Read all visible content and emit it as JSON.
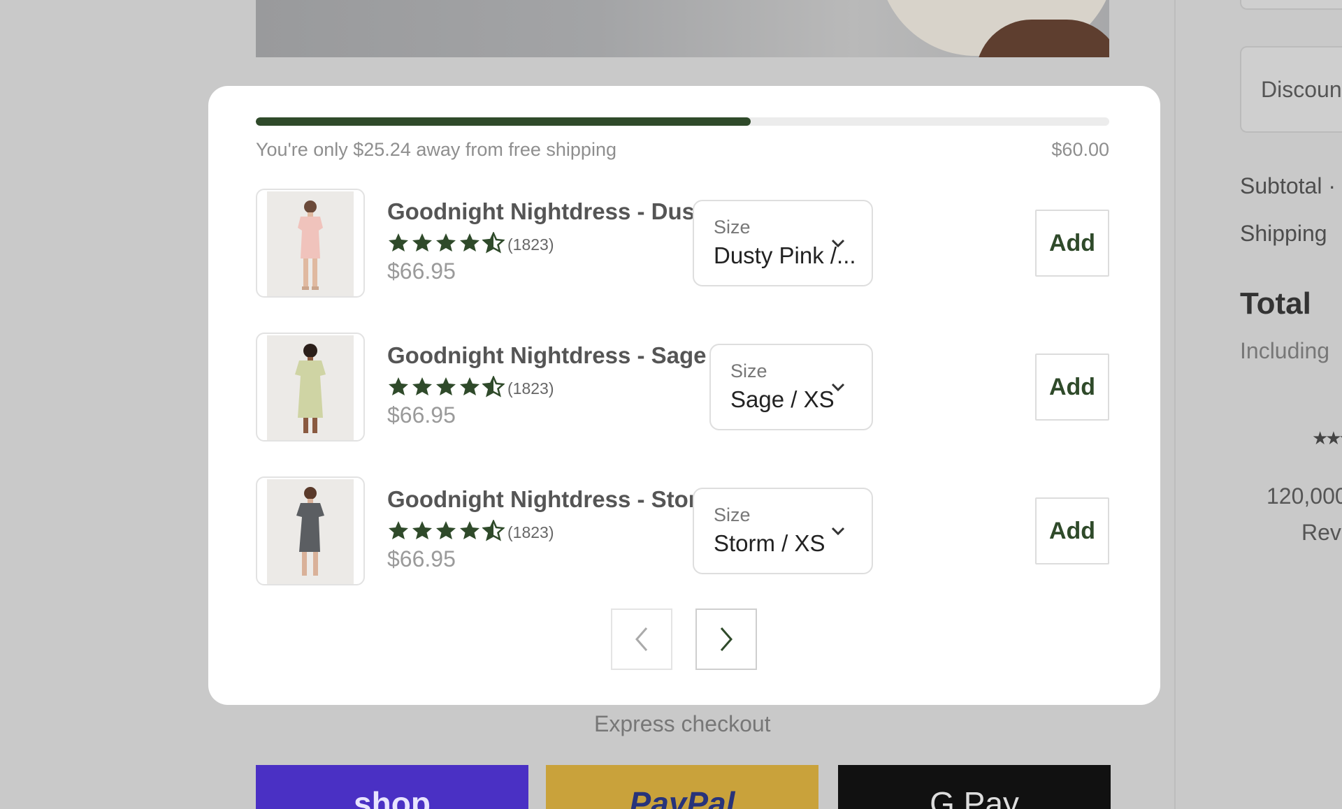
{
  "summary": {
    "discount_placeholder": "Discoun",
    "subtotal_label": "Subtotal ·",
    "shipping_label": "Shipping",
    "total_label": "Total",
    "including_label": "Including",
    "stars": "★★★",
    "reviews_count": "120,000",
    "reviews_label": "Revi"
  },
  "upsell": {
    "progress_fraction": 0.58,
    "shipping_message": "You're only $25.24 away from free shipping",
    "threshold": "$60.00",
    "products": [
      {
        "name": "Goodnight Nightdress - Dusty Pink",
        "rating_count": "(1823)",
        "price": "$66.95",
        "size_label": "Size",
        "size_value": "Dusty Pink /...",
        "add_label": "Add",
        "dress_color": "#f0c3bc"
      },
      {
        "name": "Goodnight Nightdress - Sage",
        "rating_count": "(1823)",
        "price": "$66.95",
        "size_label": "Size",
        "size_value": "Sage / XS",
        "add_label": "Add",
        "dress_color": "#cfd4a4"
      },
      {
        "name": "Goodnight Nightdress - Storm",
        "rating_count": "(1823)",
        "price": "$66.95",
        "size_label": "Size",
        "size_value": "Storm / XS",
        "add_label": "Add",
        "dress_color": "#5b5e62"
      }
    ],
    "rating_stars": 4.5
  },
  "express_checkout_label": "Express checkout",
  "payment_buttons": {
    "shop": "shop",
    "paypal": "PayPal",
    "gpay": "G Pay"
  },
  "colors": {
    "accent": "#2f4a2a",
    "overlay": "#c9c9c9"
  }
}
